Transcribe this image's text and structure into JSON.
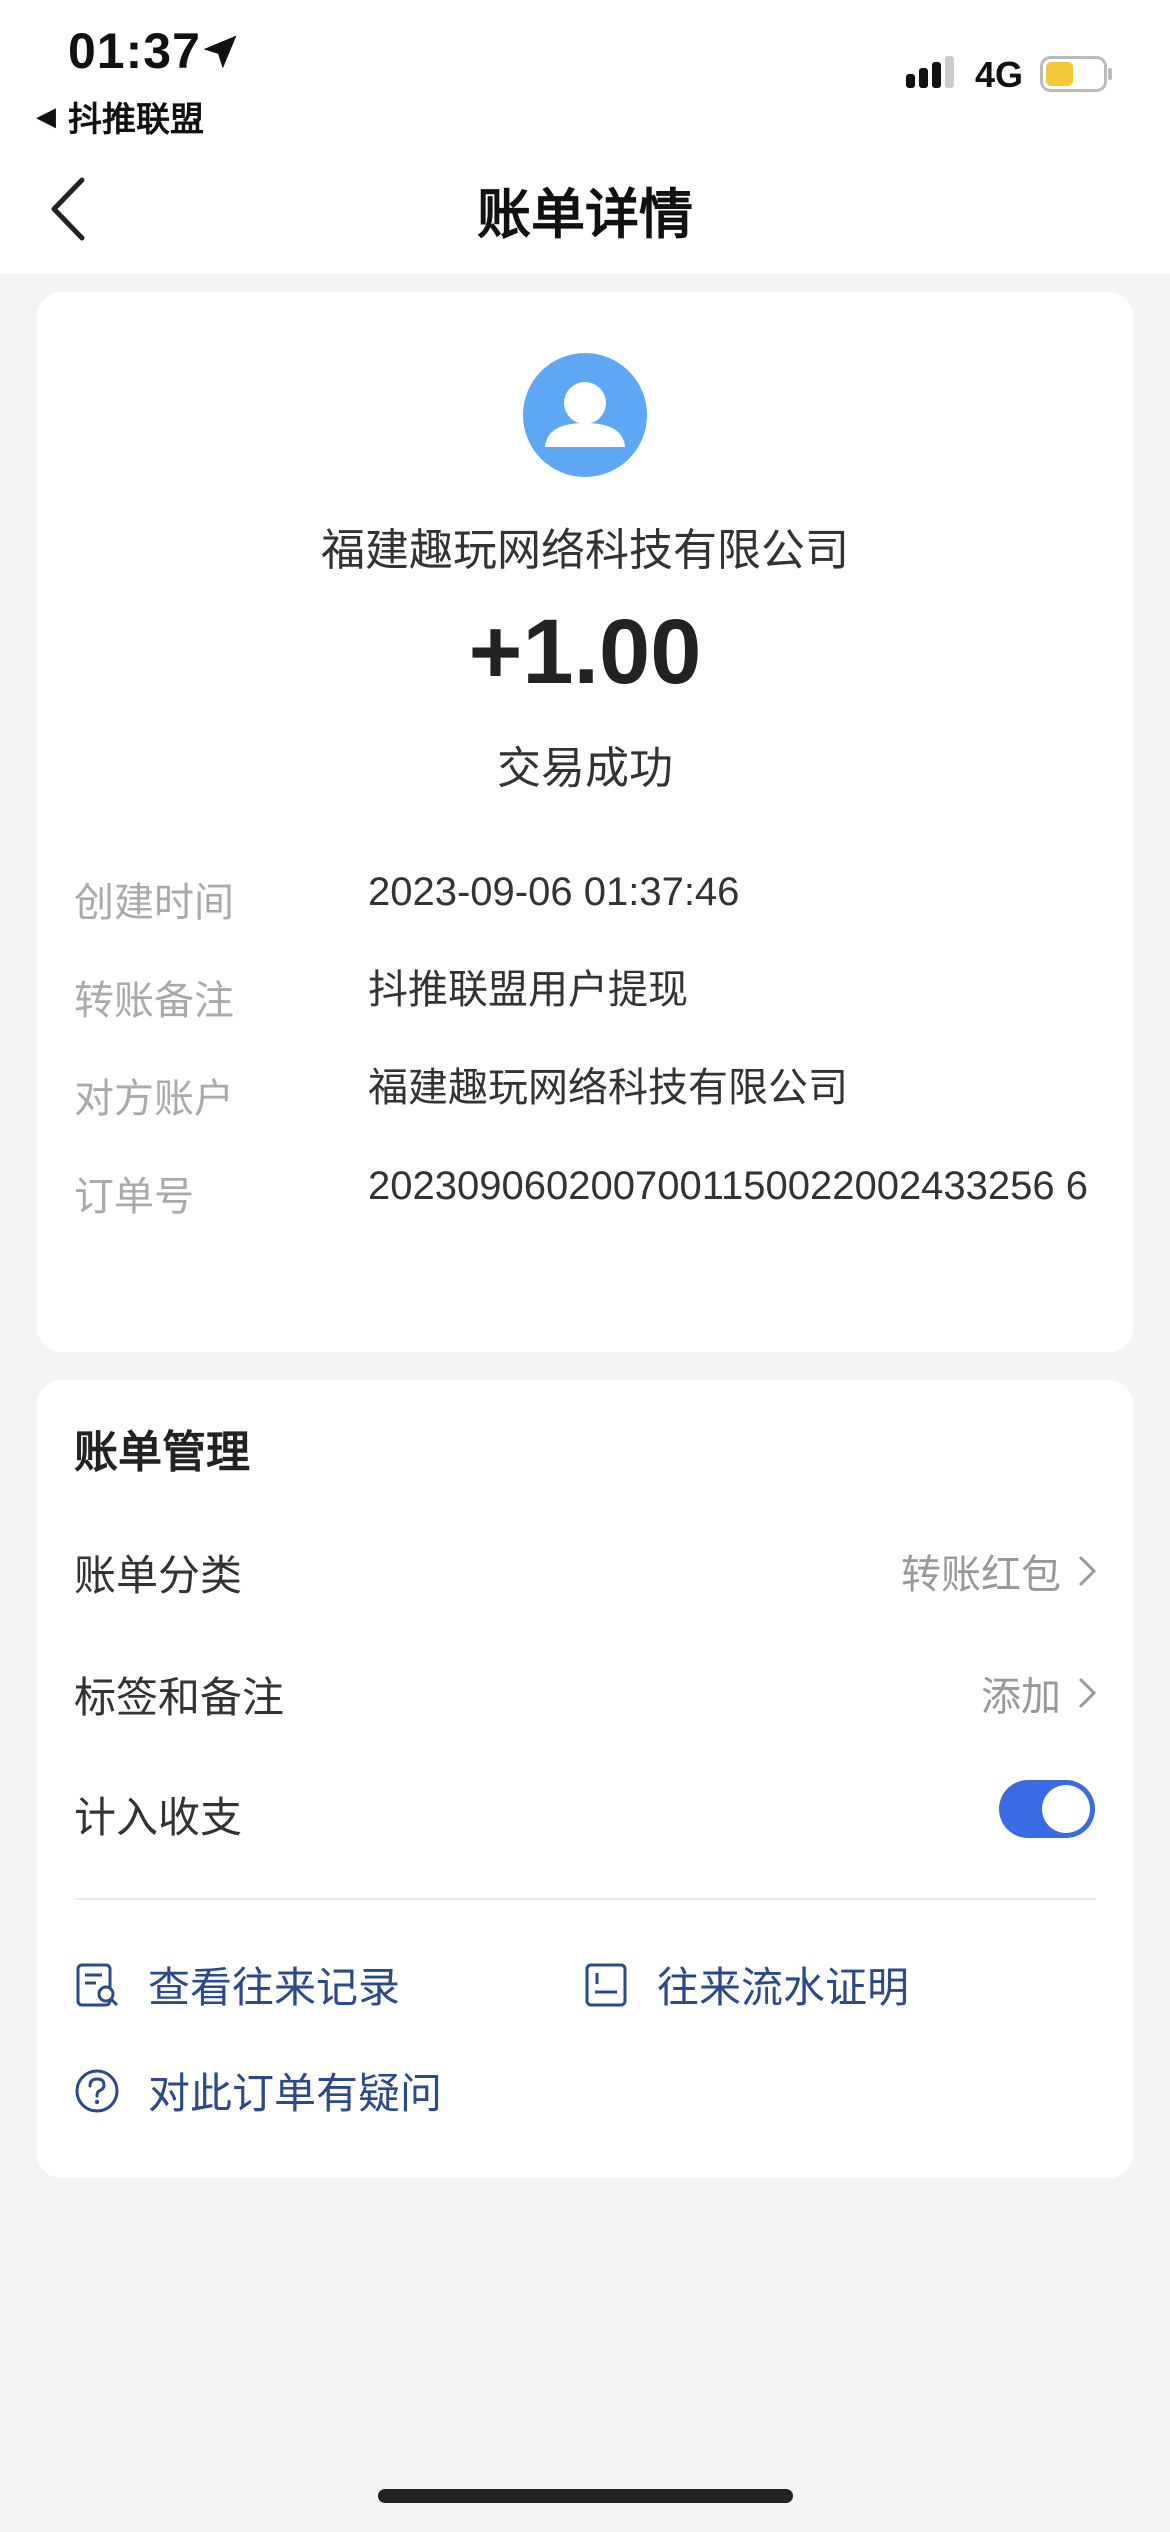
{
  "status_bar": {
    "time": "01:37",
    "back_app": "抖推联盟",
    "network": "4G",
    "battery_color": "#f5c83a"
  },
  "nav": {
    "title": "账单详情",
    "back_icon": "chevron-left-icon"
  },
  "transaction": {
    "payee": "福建趣玩网络科技有限公司",
    "amount": "+1.00",
    "status": "交易成功",
    "avatar_color": "#5ea7f5"
  },
  "details": [
    {
      "label": "创建时间",
      "value": "2023-09-06 01:37:46"
    },
    {
      "label": "转账备注",
      "value": "抖推联盟用户提现"
    },
    {
      "label": "对方账户",
      "value": "福建趣玩网络科技有限公司"
    },
    {
      "label": "订单号",
      "value": "2023090602007001150022002433256 6"
    }
  ],
  "management": {
    "title": "账单管理",
    "category_label": "账单分类",
    "category_value": "转账红包",
    "tags_label": "标签和备注",
    "tags_value": "添加",
    "include_label": "计入收支",
    "include_enabled": true,
    "toggle_color": "#3b6be3"
  },
  "links": {
    "records": "查看往来记录",
    "proof": "往来流水证明",
    "question": "对此订单有疑问",
    "link_color": "#2b4a8c"
  }
}
